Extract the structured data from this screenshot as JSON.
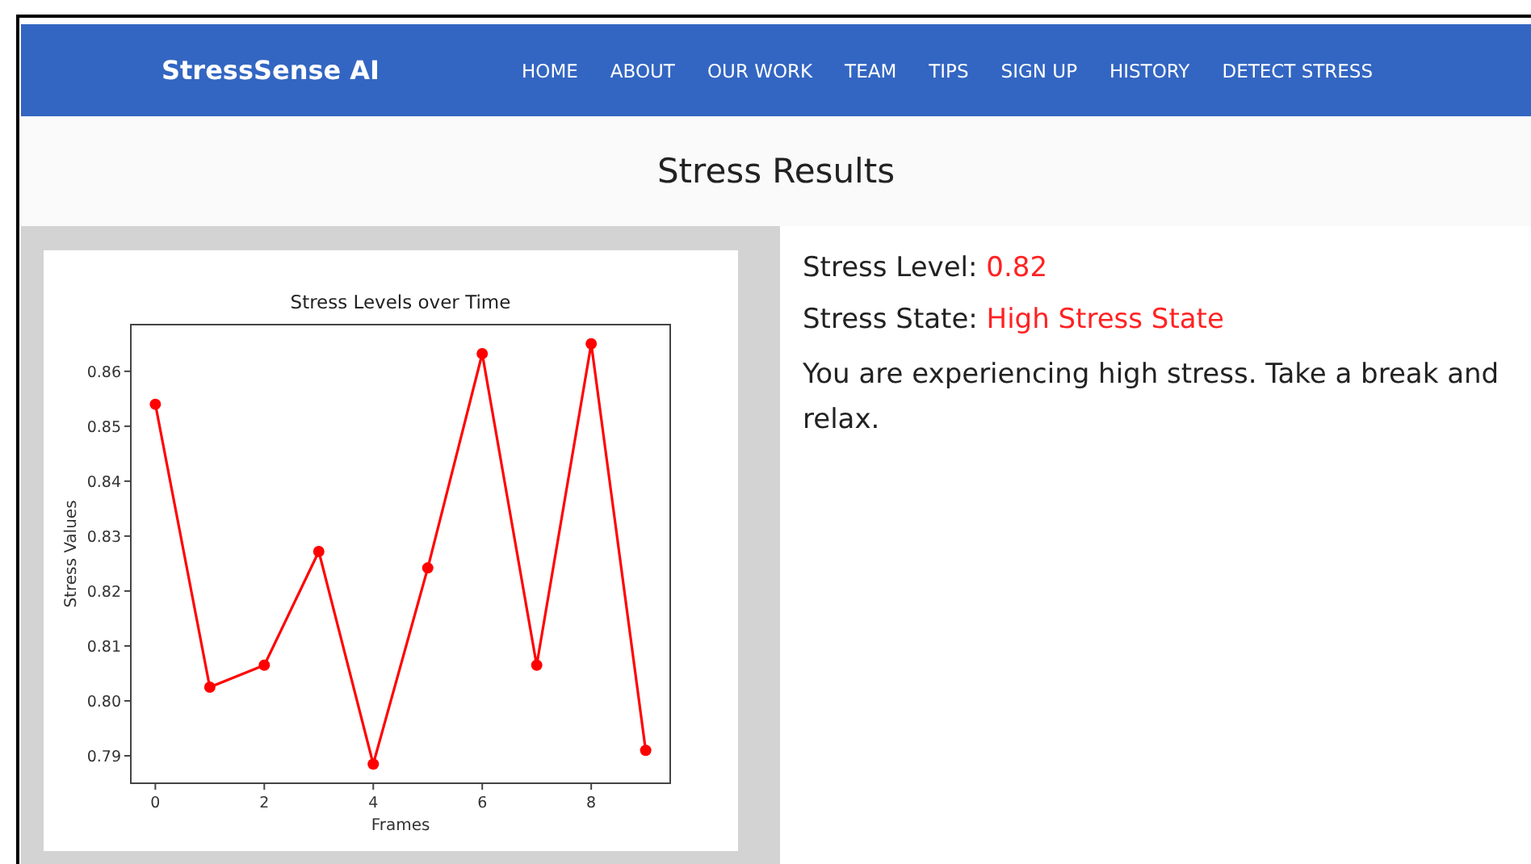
{
  "navbar": {
    "brand": "StressSense AI",
    "links": [
      {
        "label": "HOME"
      },
      {
        "label": "ABOUT"
      },
      {
        "label": "OUR WORK"
      },
      {
        "label": "TEAM"
      },
      {
        "label": "TIPS"
      },
      {
        "label": "SIGN UP"
      },
      {
        "label": "HISTORY"
      },
      {
        "label": "DETECT STRESS"
      }
    ]
  },
  "page_title": "Stress Results",
  "chart_data": {
    "type": "line",
    "title": "Stress Levels over Time",
    "xlabel": "Frames",
    "ylabel": "Stress Values",
    "x": [
      0,
      1,
      2,
      3,
      4,
      5,
      6,
      7,
      8,
      9
    ],
    "series": [
      {
        "color": "#ff0000",
        "marker": "o",
        "values": [
          0.854,
          0.8025,
          0.8065,
          0.8272,
          0.7885,
          0.8242,
          0.8632,
          0.8065,
          0.865,
          0.791
        ]
      }
    ],
    "xlim": [
      -0.45,
      9.45
    ],
    "ylim": [
      0.785,
      0.8685
    ],
    "xticks": [
      0,
      2,
      4,
      6,
      8
    ],
    "yticks": [
      {
        "value": 0.79,
        "label": "0.79"
      },
      {
        "value": 0.8,
        "label": "0.80"
      },
      {
        "value": 0.81,
        "label": "0.81"
      },
      {
        "value": 0.82,
        "label": "0.82"
      },
      {
        "value": 0.83,
        "label": "0.83"
      },
      {
        "value": 0.84,
        "label": "0.84"
      },
      {
        "value": 0.85,
        "label": "0.85"
      },
      {
        "value": 0.86,
        "label": "0.86"
      }
    ]
  },
  "results": {
    "level_label": "Stress Level:",
    "level_value": "0.82",
    "state_label": "Stress State:",
    "state_value": "High Stress State",
    "message": "You are experiencing high stress. Take a break and relax."
  }
}
